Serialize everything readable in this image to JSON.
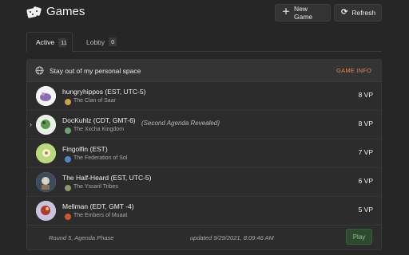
{
  "header": {
    "title": "Games",
    "new_game_label": "New Game",
    "refresh_label": "Refresh"
  },
  "tabs": [
    {
      "label": "Active",
      "count": "11"
    },
    {
      "label": "Lobby",
      "count": "0"
    }
  ],
  "game": {
    "name": "Stay out of my personal space",
    "info_label": "GAME INFO",
    "players": [
      {
        "name": "hungryhippos (EST, UTC-5)",
        "faction": "The Clan of Saar",
        "vp": "8 VP",
        "note": "",
        "faction_color": "#c9a24a",
        "avatar_color": "#f4f4f4"
      },
      {
        "name": "DocKuhlz (CDT, GMT-6)",
        "faction": "The Xxcha Kingdom",
        "vp": "8 VP",
        "note": "(Second Agenda Revealed)",
        "faction_color": "#6fa36f",
        "avatar_color": "#e9f1e6"
      },
      {
        "name": "Fingolfin (EST)",
        "faction": "The Federation of Sol",
        "vp": "7 VP",
        "note": "",
        "faction_color": "#4f86c6",
        "avatar_color": "#b9d97a"
      },
      {
        "name": "The Half-Heard (EST, UTC-5)",
        "faction": "The Yssaril Tribes",
        "vp": "6 VP",
        "note": "",
        "faction_color": "#8a9a6a",
        "avatar_color": "#3d4a5c"
      },
      {
        "name": "Mellman (EDT, GMT -4)",
        "faction": "The Embers of Muaat",
        "vp": "5 VP",
        "note": "",
        "faction_color": "#d0552e",
        "avatar_color": "#c9c2e0"
      }
    ],
    "round": "Round 5, Agenda Phase",
    "updated": "updated 9/29/2021, 8:09:46 AM",
    "play_label": "Play"
  },
  "colors": {
    "background": "#262626",
    "accent": "#e0864d",
    "play": "#8cc58c"
  }
}
